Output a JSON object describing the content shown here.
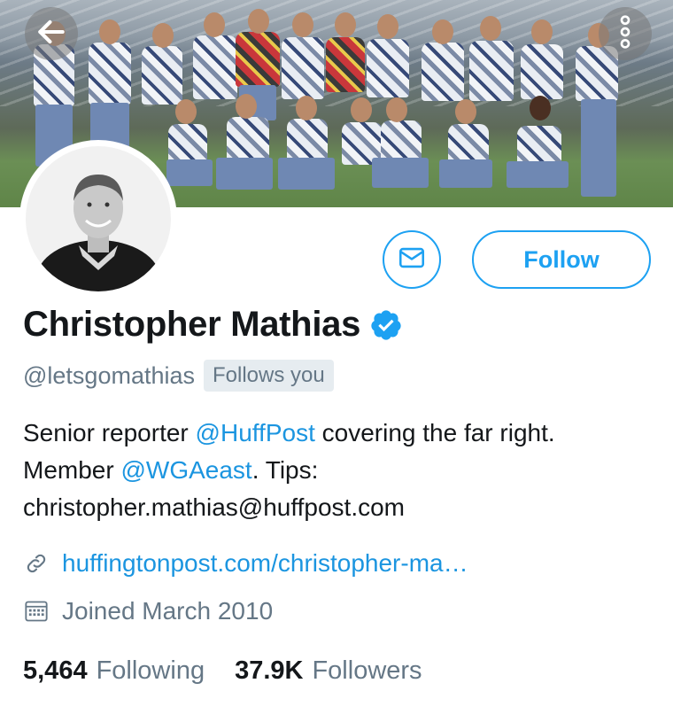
{
  "header": {
    "back_icon": "arrow-left-icon",
    "more_icon": "more-vertical-icon"
  },
  "profile": {
    "name": "Christopher Mathias",
    "handle": "@letsgomathias",
    "follows_you": "Follows you",
    "verified_icon": "verified-badge-icon",
    "bio": {
      "part1": "Senior reporter ",
      "mention1": "@HuffPost",
      "part2": " covering the far right. Member ",
      "mention2": "@WGAeast",
      "part3": ". Tips: christopher.mathias@huffpost.com"
    },
    "url": "huffingtonpost.com/christopher-ma…",
    "joined": "Joined March 2010"
  },
  "actions": {
    "follow_label": "Follow",
    "message_icon": "envelope-icon"
  },
  "stats": {
    "following_count": "5,464",
    "following_label": "Following",
    "followers_count": "37.9K",
    "followers_label": "Followers"
  },
  "colors": {
    "accent": "#1da1f2",
    "link": "#1b95e0",
    "muted": "#657786",
    "text": "#14171a"
  }
}
